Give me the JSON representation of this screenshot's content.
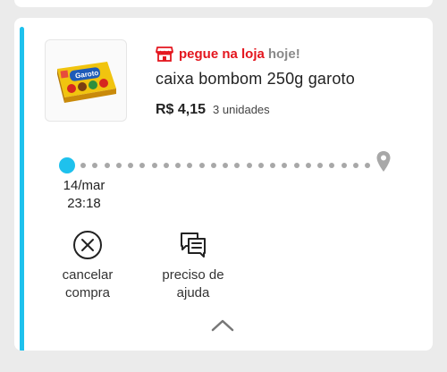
{
  "order": {
    "pickup_label": "pegue na loja",
    "pickup_when": "hoje!",
    "product_name": "caixa bombom 250g garoto",
    "price": "R$ 4,15",
    "units": "3 unidades",
    "product_image_text": "Garoto"
  },
  "timeline": {
    "date": "14/mar",
    "time": "23:18"
  },
  "actions": {
    "cancel_line1": "cancelar",
    "cancel_line2": "compra",
    "help_line1": "preciso de",
    "help_line2": "ajuda"
  },
  "colors": {
    "accent": "#1ec1ed",
    "brand_red": "#e4161e",
    "muted": "#8a8a8a"
  },
  "icons": {
    "store": "store-icon",
    "pin": "location-pin-icon",
    "cancel": "cancel-circle-icon",
    "help": "chat-help-icon",
    "collapse": "chevron-up-icon"
  }
}
